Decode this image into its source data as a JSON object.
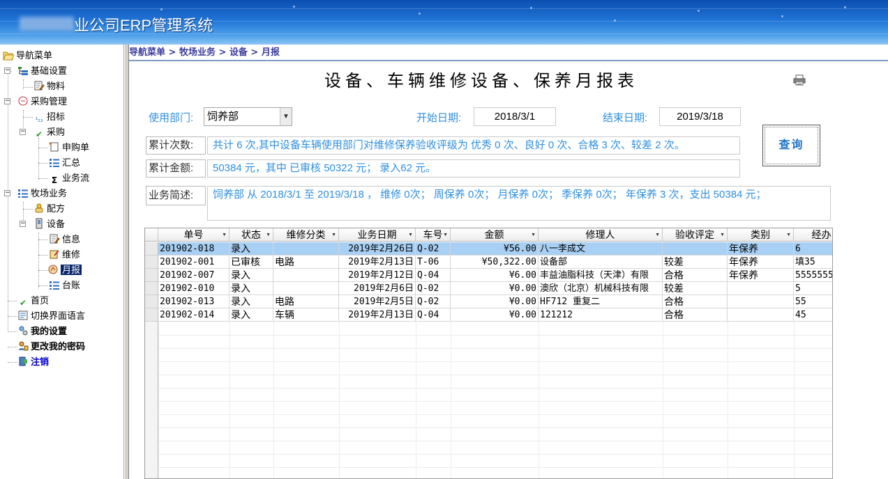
{
  "header": {
    "title": "业公司ERP管理系统"
  },
  "breadcrumb": "导航菜单 > 牧场业务 > 设备 > 月报",
  "sidebar": {
    "items": [
      {
        "label": "导航菜单",
        "icon": "folder-open-icon"
      },
      {
        "label": "基础设置",
        "icon": "settings-tree-icon"
      },
      {
        "label": "物料",
        "icon": "document-edit-icon"
      },
      {
        "label": "采购管理",
        "icon": "purchase-icon"
      },
      {
        "label": "招标",
        "icon": "number-icon"
      },
      {
        "label": "采购",
        "icon": "checkmark-icon"
      },
      {
        "label": "申购单",
        "icon": "document-sign-icon"
      },
      {
        "label": "汇总",
        "icon": "list-icon"
      },
      {
        "label": "业务流",
        "icon": "sigma-icon"
      },
      {
        "label": "牧场业务",
        "icon": "list-icon"
      },
      {
        "label": "配方",
        "icon": "formula-icon"
      },
      {
        "label": "设备",
        "icon": "device-icon"
      },
      {
        "label": "信息",
        "icon": "document-edit-icon"
      },
      {
        "label": "维修",
        "icon": "repair-icon"
      },
      {
        "label": "月报",
        "icon": "report-icon"
      },
      {
        "label": "台账",
        "icon": "list-icon"
      },
      {
        "label": "首页",
        "icon": "checkmark-icon"
      },
      {
        "label": "切换界面语言",
        "icon": "language-icon"
      },
      {
        "label": "我的设置",
        "icon": "user-settings-icon"
      },
      {
        "label": "更改我的密码",
        "icon": "password-icon"
      },
      {
        "label": "注销",
        "icon": "logout-icon"
      }
    ]
  },
  "report": {
    "title": "设备、车辆维修设备、保养月报表",
    "dept_label": "使用部门:",
    "dept_value": "饲养部",
    "start_label": "开始日期:",
    "start_value": "2018/3/1",
    "end_label": "结束日期:",
    "end_value": "2019/3/18",
    "count_label": "累计次数:",
    "count_value": "共计 6 次,其中设备车辆使用部门对维修保养验收评级为 优秀 0 次、良好 0 次、合格 3 次、较差 2 次。",
    "amount_label": "累计金额:",
    "amount_value": "50384 元，其中 已审核 50322 元；  录入62 元。",
    "summary_label": "业务简述:",
    "summary_value": "饲养部 从 2018/3/1 至 2019/3/18 ， 维修 0次；   周保养 0次；   月保养 0次；   季保养 0次；   年保养 3 次，支出 50384 元；",
    "query_button": "查询"
  },
  "grid": {
    "columns": [
      "单号",
      "状态",
      "维修分类",
      "业务日期",
      "车号",
      "金额",
      "修理人",
      "验收评定",
      "类别",
      "经办"
    ],
    "rows": [
      [
        "201902-018",
        "录入",
        "",
        "2019年2月26日",
        "Q-02",
        "¥56.00",
        "八一李成文",
        "",
        "年保养",
        "6"
      ],
      [
        "201902-001",
        "已审核",
        "电路",
        "2019年2月13日",
        "T-06",
        "¥50,322.00",
        "设备部",
        "较差",
        "年保养",
        "填35"
      ],
      [
        "201902-007",
        "录入",
        "",
        "2019年2月12日",
        "Q-04",
        "¥6.00",
        "丰益油脂科技（天津）有限",
        "合格",
        "年保养",
        "5555555"
      ],
      [
        "201902-010",
        "录入",
        "",
        "2019年2月6日",
        "Q-02",
        "¥0.00",
        "澳欣（北京）机械科技有限",
        "较差",
        "",
        "5"
      ],
      [
        "201902-013",
        "录入",
        "电路",
        "2019年2月5日",
        "Q-02",
        "¥0.00",
        "HF712 重复二",
        "合格",
        "",
        "55"
      ],
      [
        "201902-014",
        "录入",
        "车辆",
        "2019年2月13日",
        "Q-04",
        "¥0.00",
        "121212",
        "合格",
        "",
        "45"
      ]
    ],
    "selected_row": 0
  },
  "colors": {
    "accent": "#2f8fe0",
    "selection": "#a8d0f4",
    "nav_selected": "#0a246a"
  }
}
